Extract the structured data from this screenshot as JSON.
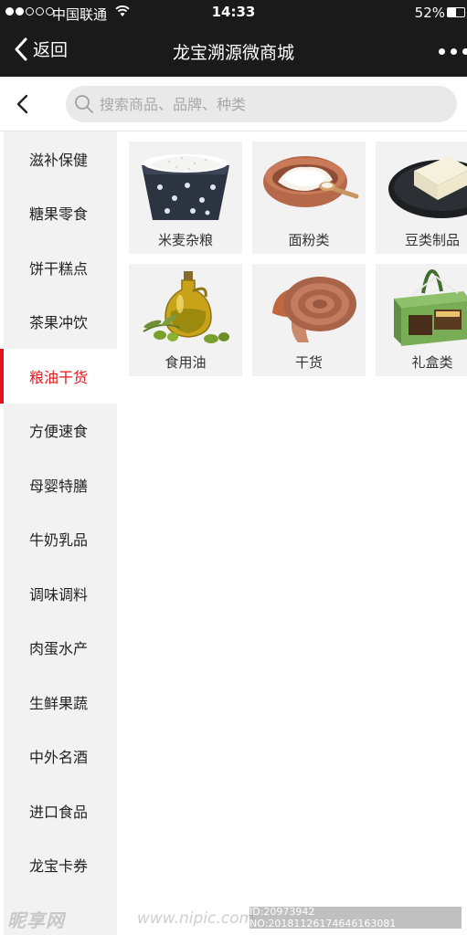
{
  "status_bar": {
    "carrier": "中国联通",
    "time": "14:33",
    "battery": "52%",
    "battery_level": 0.52,
    "signal_bars": 2
  },
  "nav": {
    "back_label": "返回",
    "title": "龙宝溯源微商城"
  },
  "search": {
    "placeholder": "搜索商品、品牌、种类",
    "value": ""
  },
  "sidebar": {
    "active_color": "#e4141b",
    "items": [
      {
        "label": "滋补保健",
        "active": false
      },
      {
        "label": "糖果零食",
        "active": false
      },
      {
        "label": "饼干糕点",
        "active": false
      },
      {
        "label": "茶果冲饮",
        "active": false
      },
      {
        "label": "粮油干货",
        "active": true
      },
      {
        "label": "方便速食",
        "active": false
      },
      {
        "label": "母婴特膳",
        "active": false
      },
      {
        "label": "牛奶乳品",
        "active": false
      },
      {
        "label": "调味调料",
        "active": false
      },
      {
        "label": "肉蛋水产",
        "active": false
      },
      {
        "label": "生鲜果蔬",
        "active": false
      },
      {
        "label": "中外名酒",
        "active": false
      },
      {
        "label": "进口食品",
        "active": false
      },
      {
        "label": "龙宝卡券",
        "active": false
      }
    ]
  },
  "products": [
    {
      "label": "米麦杂粮",
      "icon": "rice-bowl-icon"
    },
    {
      "label": "面粉类",
      "icon": "flour-bowl-icon"
    },
    {
      "label": "豆类制品",
      "icon": "tofu-plate-icon"
    },
    {
      "label": "食用油",
      "icon": "olive-oil-icon"
    },
    {
      "label": "干货",
      "icon": "mushroom-icon"
    },
    {
      "label": "礼盒类",
      "icon": "gift-box-icon"
    }
  ],
  "watermark": {
    "brand": "昵享网",
    "site": "www.nipic.com",
    "id_text": "ID:20973942 NO:20181126174646163081"
  }
}
